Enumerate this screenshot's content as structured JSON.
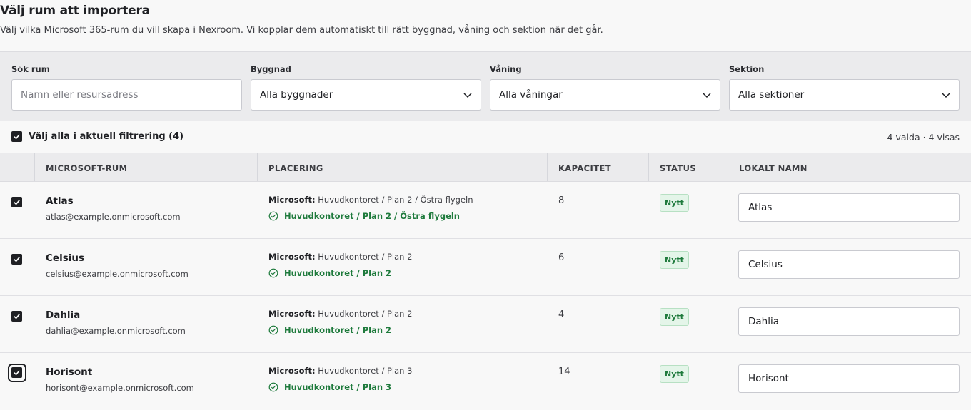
{
  "header": {
    "title": "Välj rum att importera",
    "subtitle": "Välj vilka Microsoft 365-rum du vill skapa i Nexroom. Vi kopplar dem automatiskt till rätt byggnad, våning och sektion när det går."
  },
  "filters": {
    "search": {
      "label": "Sök rum",
      "placeholder": "Namn eller resursadress",
      "value": ""
    },
    "building": {
      "label": "Byggnad",
      "value": "Alla byggnader"
    },
    "floor": {
      "label": "Våning",
      "value": "Alla våningar"
    },
    "section": {
      "label": "Sektion",
      "value": "Alla sektioner"
    }
  },
  "selection": {
    "select_all_label": "Välj alla i aktuell filtrering (4)",
    "select_all_checked": true,
    "count_text": "4 valda · 4 visas"
  },
  "table": {
    "columns": [
      "MICROSOFT-RUM",
      "PLACERING",
      "KAPACITET",
      "STATUS",
      "LOKALT NAMN"
    ],
    "rows": [
      {
        "name": "Atlas",
        "email": "atlas@example.onmicrosoft.com",
        "ms_prefix": "Microsoft:",
        "ms_path": "Huvudkontoret / Plan 2 / Östra flygeln",
        "matched": "Huvudkontoret / Plan 2 / Östra flygeln",
        "capacity": "8",
        "status": "Nytt",
        "local_name": "Atlas",
        "checked": true
      },
      {
        "name": "Celsius",
        "email": "celsius@example.onmicrosoft.com",
        "ms_prefix": "Microsoft:",
        "ms_path": "Huvudkontoret / Plan 2",
        "matched": "Huvudkontoret / Plan 2",
        "capacity": "6",
        "status": "Nytt",
        "local_name": "Celsius",
        "checked": true
      },
      {
        "name": "Dahlia",
        "email": "dahlia@example.onmicrosoft.com",
        "ms_prefix": "Microsoft:",
        "ms_path": "Huvudkontoret / Plan 2",
        "matched": "Huvudkontoret / Plan 2",
        "capacity": "4",
        "status": "Nytt",
        "local_name": "Dahlia",
        "checked": true
      },
      {
        "name": "Horisont",
        "email": "horisont@example.onmicrosoft.com",
        "ms_prefix": "Microsoft:",
        "ms_path": "Huvudkontoret / Plan 3",
        "matched": "Huvudkontoret / Plan 3",
        "capacity": "14",
        "status": "Nytt",
        "local_name": "Horisont",
        "checked": true
      }
    ]
  },
  "colors": {
    "accent_green": "#1e7a3c",
    "badge_bg": "#e4f5e9",
    "checkbox": "#1f2024"
  },
  "icons": {
    "checkbox": "check-icon",
    "dropdown": "chevron-down-icon",
    "match": "check-circle-icon"
  }
}
